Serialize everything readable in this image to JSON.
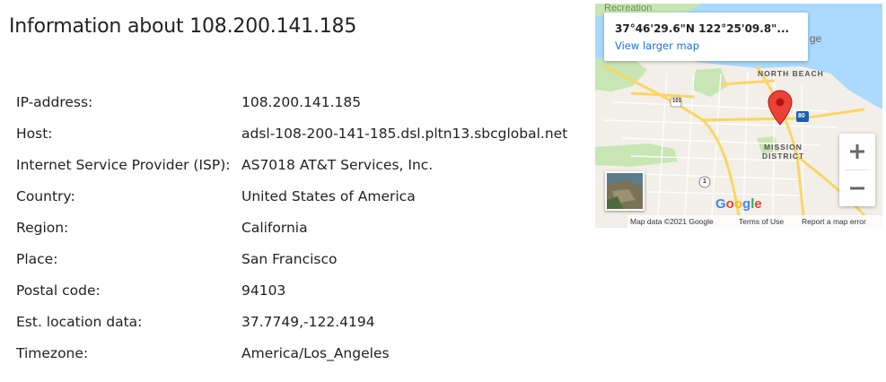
{
  "page": {
    "title": "Information about 108.200.141.185"
  },
  "info": {
    "rows": [
      {
        "label": "IP-address:",
        "value": "108.200.141.185"
      },
      {
        "label": "Host:",
        "value": "adsl-108-200-141-185.dsl.pltn13.sbcglobal.net"
      },
      {
        "label": "Internet Service Provider (ISP):",
        "value": "AS7018 AT&T Services, Inc."
      },
      {
        "label": "Country:",
        "value": "United States of America"
      },
      {
        "label": "Region:",
        "value": "California"
      },
      {
        "label": "Place:",
        "value": "San Francisco"
      },
      {
        "label": "Postal code:",
        "value": "94103"
      },
      {
        "label": "Est. location data:",
        "value": "37.7749,-122.4194"
      },
      {
        "label": "Timezone:",
        "value": "America/Los_Angeles"
      }
    ]
  },
  "map": {
    "info_window": {
      "coords": "37°46'29.6\"N 122°25'09.8\"...",
      "link": "View larger map"
    },
    "labels": {
      "recreation": "Recreation",
      "north_beach": "NORTH BEACH",
      "mission_line1": "MISSION",
      "mission_line2": "DISTRICT",
      "ge": "ge",
      "route_shield_101": "101",
      "route_shield_80": "80",
      "route_shield_1": "1"
    },
    "zoom_in": "+",
    "zoom_out": "−",
    "google_logo": "Google",
    "attribution": {
      "data": "Map data ©2021 Google",
      "terms": "Terms of Use",
      "report": "Report a map error"
    },
    "colors": {
      "water": "#aadaff",
      "land": "#f2efe9",
      "park": "#c8e6b4",
      "road": "#fbd565",
      "pin": "#ea4335"
    }
  }
}
